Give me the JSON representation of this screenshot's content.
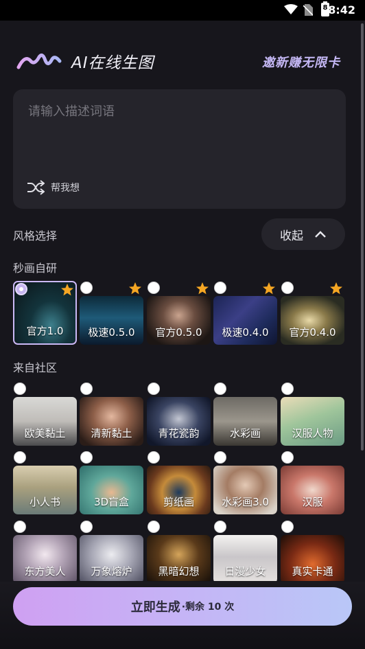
{
  "status_bar": {
    "time": "8:42",
    "battery_level": "8"
  },
  "header": {
    "title": "AI在线生图",
    "invite": "邀新赚无限卡"
  },
  "prompt": {
    "placeholder": "请输入描述词语",
    "help_label": "帮我想"
  },
  "style_section": {
    "title": "风格选择",
    "collapse_label": "收起"
  },
  "official": {
    "title": "秒画自研",
    "items": [
      {
        "label": "官方1.0",
        "selected": true,
        "starred": true
      },
      {
        "label": "极速0.5.0",
        "selected": false,
        "starred": true
      },
      {
        "label": "官方0.5.0",
        "selected": false,
        "starred": true
      },
      {
        "label": "极速0.4.0",
        "selected": false,
        "starred": true
      },
      {
        "label": "官方0.4.0",
        "selected": false,
        "starred": true
      }
    ]
  },
  "community": {
    "title": "来自社区",
    "items": [
      {
        "label": "欧美黏土"
      },
      {
        "label": "清新黏土"
      },
      {
        "label": "青花瓷韵"
      },
      {
        "label": "水彩画"
      },
      {
        "label": "汉服人物"
      },
      {
        "label": "小人书"
      },
      {
        "label": "3D盲盒"
      },
      {
        "label": "剪纸画"
      },
      {
        "label": "水彩画3.0"
      },
      {
        "label": "汉服"
      },
      {
        "label": "东方美人"
      },
      {
        "label": "万象熔炉"
      },
      {
        "label": "黑暗幻想"
      },
      {
        "label": "日漫少女"
      },
      {
        "label": "真实卡通"
      }
    ]
  },
  "footer": {
    "generate_label": "立即生成",
    "remaining": "·剩余 10 次"
  },
  "colors": {
    "background": "#17161c",
    "panel": "#25242b",
    "accent": "#c7b5f0",
    "star": "#f5a623"
  }
}
